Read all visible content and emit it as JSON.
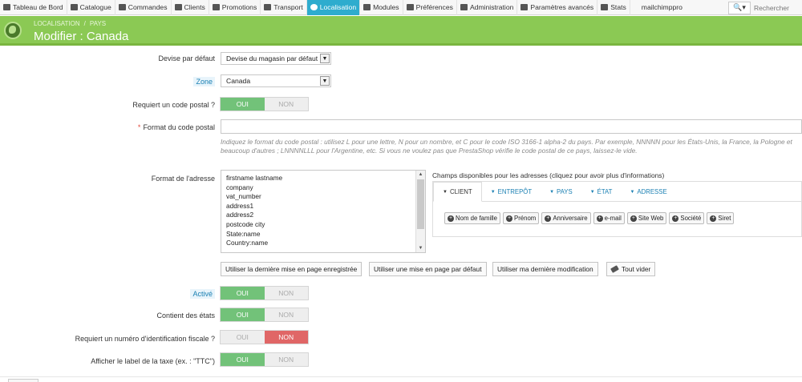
{
  "nav": {
    "items": [
      {
        "label": "Tableau de Bord",
        "icon": "dashboard-icon"
      },
      {
        "label": "Catalogue",
        "icon": "book-icon"
      },
      {
        "label": "Commandes",
        "icon": "credit-card-icon"
      },
      {
        "label": "Clients",
        "icon": "users-icon"
      },
      {
        "label": "Promotions",
        "icon": "tag-icon"
      },
      {
        "label": "Transport",
        "icon": "truck-icon"
      },
      {
        "label": "Localisation",
        "icon": "globe-icon"
      },
      {
        "label": "Modules",
        "icon": "puzzle-icon"
      },
      {
        "label": "Préférences",
        "icon": "wrench-icon"
      },
      {
        "label": "Administration",
        "icon": "cog-icon"
      },
      {
        "label": "Paramètres avancés",
        "icon": "cogs-icon"
      },
      {
        "label": "Stats",
        "icon": "bar-chart-icon"
      },
      {
        "label": "mailchimppro",
        "icon": ""
      }
    ],
    "active": "Localisation",
    "search_placeholder": "Rechercher",
    "search_caret": "▾"
  },
  "header": {
    "breadcrumb": [
      "LOCALISATION",
      "PAYS"
    ],
    "breadcrumb_sep": "/",
    "title": "Modifier : Canada",
    "accent": "#8bc954"
  },
  "form": {
    "currency": {
      "label": "Devise par défaut",
      "value": "Devise du magasin par défaut"
    },
    "zone": {
      "label": "Zone",
      "value": "Canada"
    },
    "zip_required": {
      "label": "Requiert un code postal ?",
      "on": "OUI",
      "off": "NON",
      "state": "on"
    },
    "zip_format": {
      "label": "Format du code postal",
      "required_mark": "*",
      "value": "",
      "help": "Indiquez le format du code postal : utilisez L pour une lettre, N pour un nombre, et C pour le code ISO 3166-1 alpha-2 du pays. Par exemple, NNNNN pour les États-Unis, la France, la Pologne et beaucoup d'autres ; LNNNNLLL pour l'Argentine, etc. Si vous ne voulez pas que PrestaShop vérifie le code postal de ce pays, laissez-le vide."
    },
    "address_format": {
      "label": "Format de l'adresse",
      "lines": [
        "firstname lastname",
        "company",
        "vat_number",
        "address1",
        "address2",
        "postcode city",
        "State:name",
        "Country:name"
      ]
    },
    "fields_title": "Champs disponibles pour les adresses (cliquez pour avoir plus d'informations)",
    "tabs": [
      "CLIENT",
      "ENTREPÔT",
      "PAYS",
      "ÉTAT",
      "ADRESSE"
    ],
    "active_tab": "CLIENT",
    "pills": [
      "Nom de famille",
      "Prénom",
      "Anniversaire",
      "e-mail",
      "Site Web",
      "Société",
      "Siret"
    ],
    "buttons": {
      "last_saved": "Utiliser la dernière mise en page enregistrée",
      "default": "Utiliser une mise en page par défaut",
      "last_modif": "Utiliser ma dernière modification",
      "clear": "Tout vider"
    },
    "active": {
      "label": "Activé",
      "on": "OUI",
      "off": "NON",
      "state": "on"
    },
    "contains_states": {
      "label": "Contient des états",
      "on": "OUI",
      "off": "NON",
      "state": "on"
    },
    "tax_id": {
      "label": "Requiert un numéro d'identification fiscale ?",
      "on": "OUI",
      "off": "NON",
      "state": "off"
    },
    "tax_label": {
      "label": "Afficher le label de la taxe (ex. : \"TTC\")",
      "on": "OUI",
      "off": "NON",
      "state": "on"
    }
  }
}
